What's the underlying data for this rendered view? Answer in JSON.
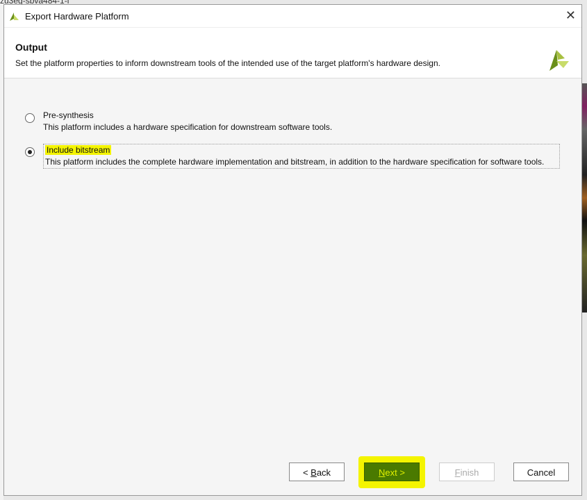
{
  "background": {
    "partial_text": "zu3eg-sbva484-1-i"
  },
  "dialog": {
    "title": "Export Hardware Platform",
    "header_title": "Output",
    "header_description": "Set the platform properties to inform downstream tools of the intended use of the target platform's hardware design.",
    "options": [
      {
        "label": "Pre-synthesis",
        "description": "This platform includes a hardware specification for downstream software tools.",
        "selected": false
      },
      {
        "label": "Include bitstream",
        "description": "This platform includes the complete hardware implementation and bitstream, in addition to the hardware specification for software tools.",
        "selected": true
      }
    ],
    "buttons": {
      "back_prefix": "< ",
      "back_key": "B",
      "back_rest": "ack",
      "next_key": "N",
      "next_rest": "ext >",
      "finish_key": "F",
      "finish_rest": "inish",
      "cancel": "Cancel"
    }
  },
  "colors": {
    "highlight": "#f4f400",
    "next_bg": "#4a7a00",
    "logo_dark": "#6a8f1a",
    "logo_light": "#c8dc6a"
  }
}
